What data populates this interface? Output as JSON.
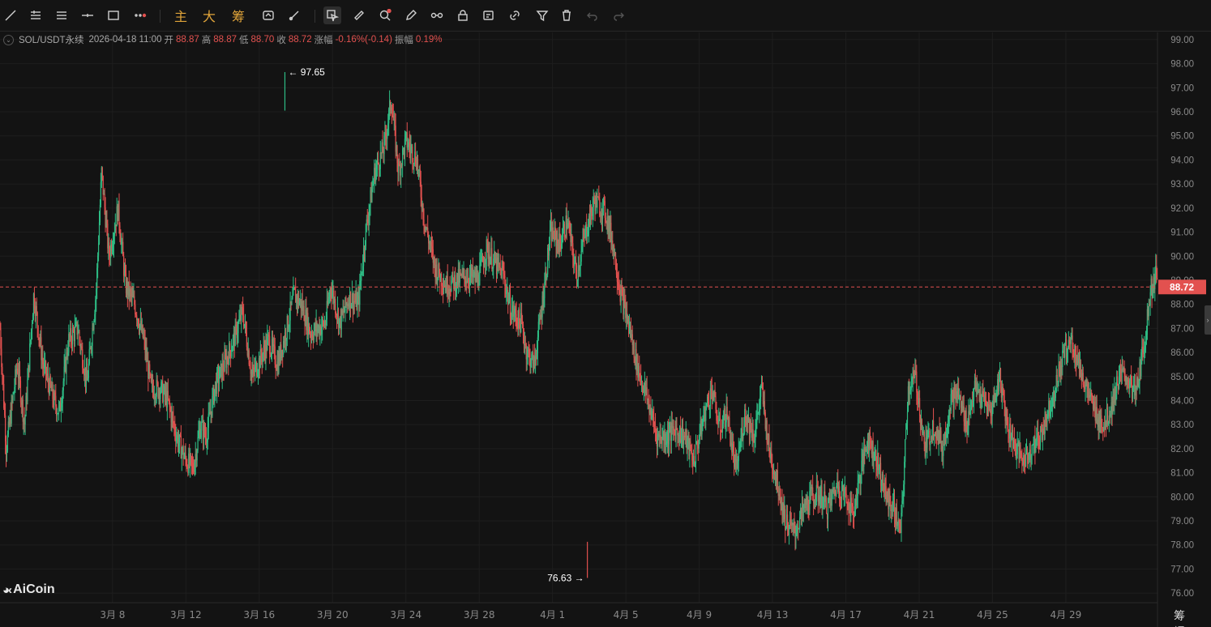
{
  "toolbar": {
    "tools": [
      {
        "name": "trend-line-icon"
      },
      {
        "name": "multi-line-icon"
      },
      {
        "name": "parallel-lines-icon"
      },
      {
        "name": "horizontal-line-icon"
      },
      {
        "name": "rectangle-icon"
      },
      {
        "name": "more-tools-icon"
      }
    ],
    "indicator_tabs": [
      "主",
      "大",
      "筹"
    ],
    "right_tools": [
      {
        "name": "replay-icon"
      },
      {
        "name": "brush-icon"
      },
      {
        "name": "select-cursor-icon"
      },
      {
        "name": "ruler-icon"
      },
      {
        "name": "magnet-zoom-icon"
      },
      {
        "name": "pen-icon"
      },
      {
        "name": "connect-icon"
      },
      {
        "name": "lock-icon"
      },
      {
        "name": "edit-icon"
      },
      {
        "name": "link-icon"
      },
      {
        "name": "filter-icon"
      },
      {
        "name": "trash-icon"
      },
      {
        "name": "undo-icon"
      },
      {
        "name": "redo-icon"
      }
    ]
  },
  "info": {
    "symbol": "SOL/USDT永续",
    "datetime": "2026-04-18 11:00",
    "open_label": "开",
    "open": "88.87",
    "high_label": "高",
    "high": "88.87",
    "low_label": "低",
    "low": "88.70",
    "close_label": "收",
    "close": "88.72",
    "change_label": "涨幅",
    "change": "-0.16%(-0.14)",
    "amplitude_label": "振幅",
    "amplitude": "0.19%"
  },
  "logo": "AiCoin",
  "corner_labels": [
    "筹",
    "爆"
  ],
  "colors": {
    "up": "#2ebd85",
    "down": "#e2514f",
    "background": "#131313",
    "grid": "#1e1e1e",
    "price_line": "#e2514f"
  },
  "chart_data": {
    "type": "candlestick",
    "symbol": "SOL/USDT永续",
    "y_ticks": [
      "76.00",
      "77.00",
      "78.00",
      "79.00",
      "80.00",
      "81.00",
      "82.00",
      "83.00",
      "84.00",
      "85.00",
      "86.00",
      "87.00",
      "88.00",
      "89.00",
      "90.00",
      "91.00",
      "92.00",
      "93.00",
      "94.00",
      "95.00",
      "96.00",
      "97.00",
      "98.00",
      "99.00"
    ],
    "ylim": [
      75.6,
      99.3
    ],
    "x_ticks": [
      "3月 8",
      "3月 12",
      "3月 16",
      "3月 20",
      "3月 24",
      "3月 28",
      "4月 1",
      "4月 5",
      "4月 9",
      "4月 13",
      "4月 17",
      "4月 21",
      "4月 25",
      "4月 29"
    ],
    "x_tick_days": [
      8,
      12,
      16,
      20,
      24,
      28,
      32,
      36,
      40,
      44,
      48,
      52,
      56,
      60
    ],
    "xlim_days": [
      1.86,
      65.0
    ],
    "last_price": "88.72",
    "high_marker": {
      "label": "97.65",
      "price": 97.65,
      "day": 17.4
    },
    "low_marker": {
      "label": "76.63",
      "price": 76.63,
      "day": 33.9
    },
    "path": [
      [
        1.86,
        87.0
      ],
      [
        2.2,
        82.0
      ],
      [
        2.8,
        85.5
      ],
      [
        3.2,
        83.0
      ],
      [
        3.7,
        88.4
      ],
      [
        4.2,
        85.5
      ],
      [
        4.8,
        84.0
      ],
      [
        5.1,
        83.5
      ],
      [
        5.6,
        86.5
      ],
      [
        6.1,
        87.0
      ],
      [
        6.6,
        84.7
      ],
      [
        7.1,
        88.5
      ],
      [
        7.4,
        93.5
      ],
      [
        7.8,
        90.0
      ],
      [
        8.3,
        92.0
      ],
      [
        8.7,
        88.8
      ],
      [
        9.2,
        88.0
      ],
      [
        9.7,
        86.5
      ],
      [
        10.1,
        84.5
      ],
      [
        10.6,
        84.5
      ],
      [
        11.0,
        84.0
      ],
      [
        11.5,
        82.5
      ],
      [
        12.0,
        81.5
      ],
      [
        12.4,
        81.2
      ],
      [
        12.8,
        83.0
      ],
      [
        13.1,
        82.5
      ],
      [
        13.6,
        84.6
      ],
      [
        14.1,
        85.5
      ],
      [
        14.6,
        86.5
      ],
      [
        15.1,
        87.7
      ],
      [
        15.6,
        85.0
      ],
      [
        16.1,
        85.8
      ],
      [
        16.5,
        86.5
      ],
      [
        17.0,
        85.5
      ],
      [
        17.5,
        87.0
      ],
      [
        17.9,
        88.4
      ],
      [
        18.3,
        88.0
      ],
      [
        18.8,
        86.8
      ],
      [
        19.2,
        87.0
      ],
      [
        19.6,
        87.2
      ],
      [
        19.9,
        88.8
      ],
      [
        20.4,
        87.2
      ],
      [
        20.9,
        88.3
      ],
      [
        21.4,
        88.0
      ],
      [
        21.8,
        91.0
      ],
      [
        22.3,
        93.5
      ],
      [
        22.8,
        94.5
      ],
      [
        23.2,
        96.5
      ],
      [
        23.6,
        93.5
      ],
      [
        24.0,
        94.8
      ],
      [
        24.6,
        94.0
      ],
      [
        25.0,
        91.5
      ],
      [
        25.6,
        89.5
      ],
      [
        26.2,
        88.8
      ],
      [
        26.8,
        89.0
      ],
      [
        27.4,
        89.2
      ],
      [
        27.9,
        89.0
      ],
      [
        28.4,
        90.3
      ],
      [
        29.0,
        89.5
      ],
      [
        29.3,
        89.3
      ],
      [
        29.7,
        87.8
      ],
      [
        30.3,
        87.2
      ],
      [
        30.6,
        86.0
      ],
      [
        31.0,
        85.5
      ],
      [
        31.4,
        87.8
      ],
      [
        31.9,
        91.0
      ],
      [
        32.4,
        90.5
      ],
      [
        32.8,
        91.5
      ],
      [
        33.3,
        89.2
      ],
      [
        33.8,
        91.0
      ],
      [
        34.3,
        92.3
      ],
      [
        34.9,
        91.8
      ],
      [
        35.3,
        90.5
      ],
      [
        35.7,
        88.5
      ],
      [
        36.2,
        87.0
      ],
      [
        36.6,
        85.5
      ],
      [
        37.2,
        84.0
      ],
      [
        37.7,
        82.5
      ],
      [
        38.2,
        82.5
      ],
      [
        38.7,
        82.8
      ],
      [
        39.2,
        82.5
      ],
      [
        39.7,
        81.5
      ],
      [
        40.3,
        83.5
      ],
      [
        40.7,
        84.5
      ],
      [
        41.1,
        82.8
      ],
      [
        41.5,
        83.5
      ],
      [
        42.0,
        81.0
      ],
      [
        42.5,
        83.5
      ],
      [
        43.0,
        82.5
      ],
      [
        43.4,
        84.5
      ],
      [
        43.8,
        82.0
      ],
      [
        44.3,
        80.5
      ],
      [
        44.7,
        79.0
      ],
      [
        45.2,
        78.5
      ],
      [
        45.7,
        79.5
      ],
      [
        46.1,
        80.0
      ],
      [
        46.6,
        80.1
      ],
      [
        47.0,
        79.5
      ],
      [
        47.5,
        80.5
      ],
      [
        48.0,
        80.0
      ],
      [
        48.4,
        79.3
      ],
      [
        48.8,
        81.0
      ],
      [
        49.2,
        82.5
      ],
      [
        49.7,
        81.5
      ],
      [
        50.2,
        80.0
      ],
      [
        50.6,
        79.5
      ],
      [
        51.0,
        78.5
      ],
      [
        51.4,
        84.5
      ],
      [
        51.8,
        85.0
      ],
      [
        52.3,
        82.0
      ],
      [
        52.8,
        83.0
      ],
      [
        53.3,
        82.0
      ],
      [
        53.7,
        84.0
      ],
      [
        54.1,
        84.3
      ],
      [
        54.6,
        83.0
      ],
      [
        55.0,
        84.5
      ],
      [
        55.5,
        84.0
      ],
      [
        55.9,
        83.5
      ],
      [
        56.4,
        85.0
      ],
      [
        56.8,
        83.0
      ],
      [
        57.3,
        82.0
      ],
      [
        57.7,
        81.5
      ],
      [
        58.1,
        82.0
      ],
      [
        58.6,
        82.5
      ],
      [
        59.0,
        83.5
      ],
      [
        59.4,
        84.5
      ],
      [
        59.9,
        86.0
      ],
      [
        60.3,
        86.5
      ],
      [
        60.7,
        85.5
      ],
      [
        61.2,
        84.3
      ],
      [
        61.6,
        83.5
      ],
      [
        62.1,
        83.0
      ],
      [
        62.5,
        83.8
      ],
      [
        62.9,
        85.0
      ],
      [
        63.3,
        85.0
      ],
      [
        63.8,
        84.2
      ],
      [
        64.3,
        86.5
      ],
      [
        64.6,
        88.5
      ],
      [
        65.0,
        89.5
      ]
    ]
  }
}
